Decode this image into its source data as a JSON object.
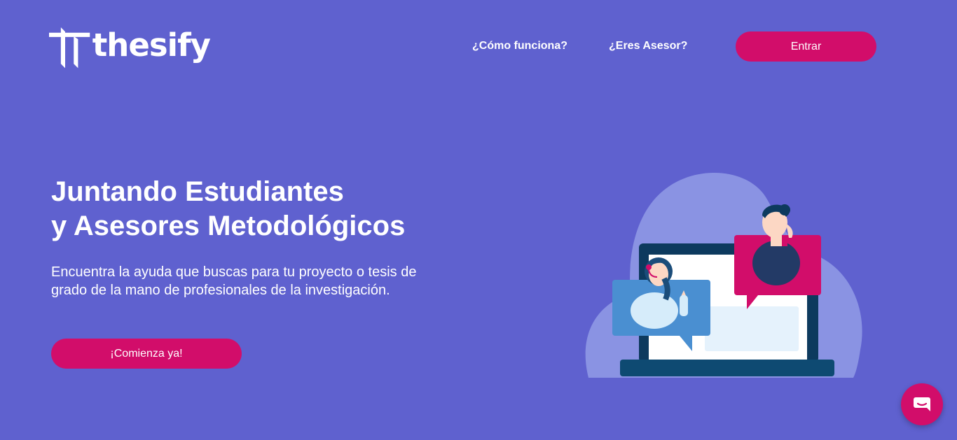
{
  "header": {
    "brand": "thesify",
    "nav": {
      "como_funciona": "¿Cómo funciona?",
      "eres_asesor": "¿Eres Asesor?"
    },
    "login_label": "Entrar"
  },
  "hero": {
    "title_line1": "Juntando Estudiantes",
    "title_line2": "y Asesores Metodológicos",
    "description": "Encuentra la ayuda que buscas para tu proyecto o tesis de grado de la mano de profesionales de la investigación.",
    "cta_label": "¡Comienza ya!",
    "illustration_icon": "video-call-illustration"
  },
  "chat_widget": {
    "icon": "chat-icon"
  },
  "colors": {
    "background": "#5F61CF",
    "accent": "#D20D6A",
    "text": "#FFFFFF"
  }
}
